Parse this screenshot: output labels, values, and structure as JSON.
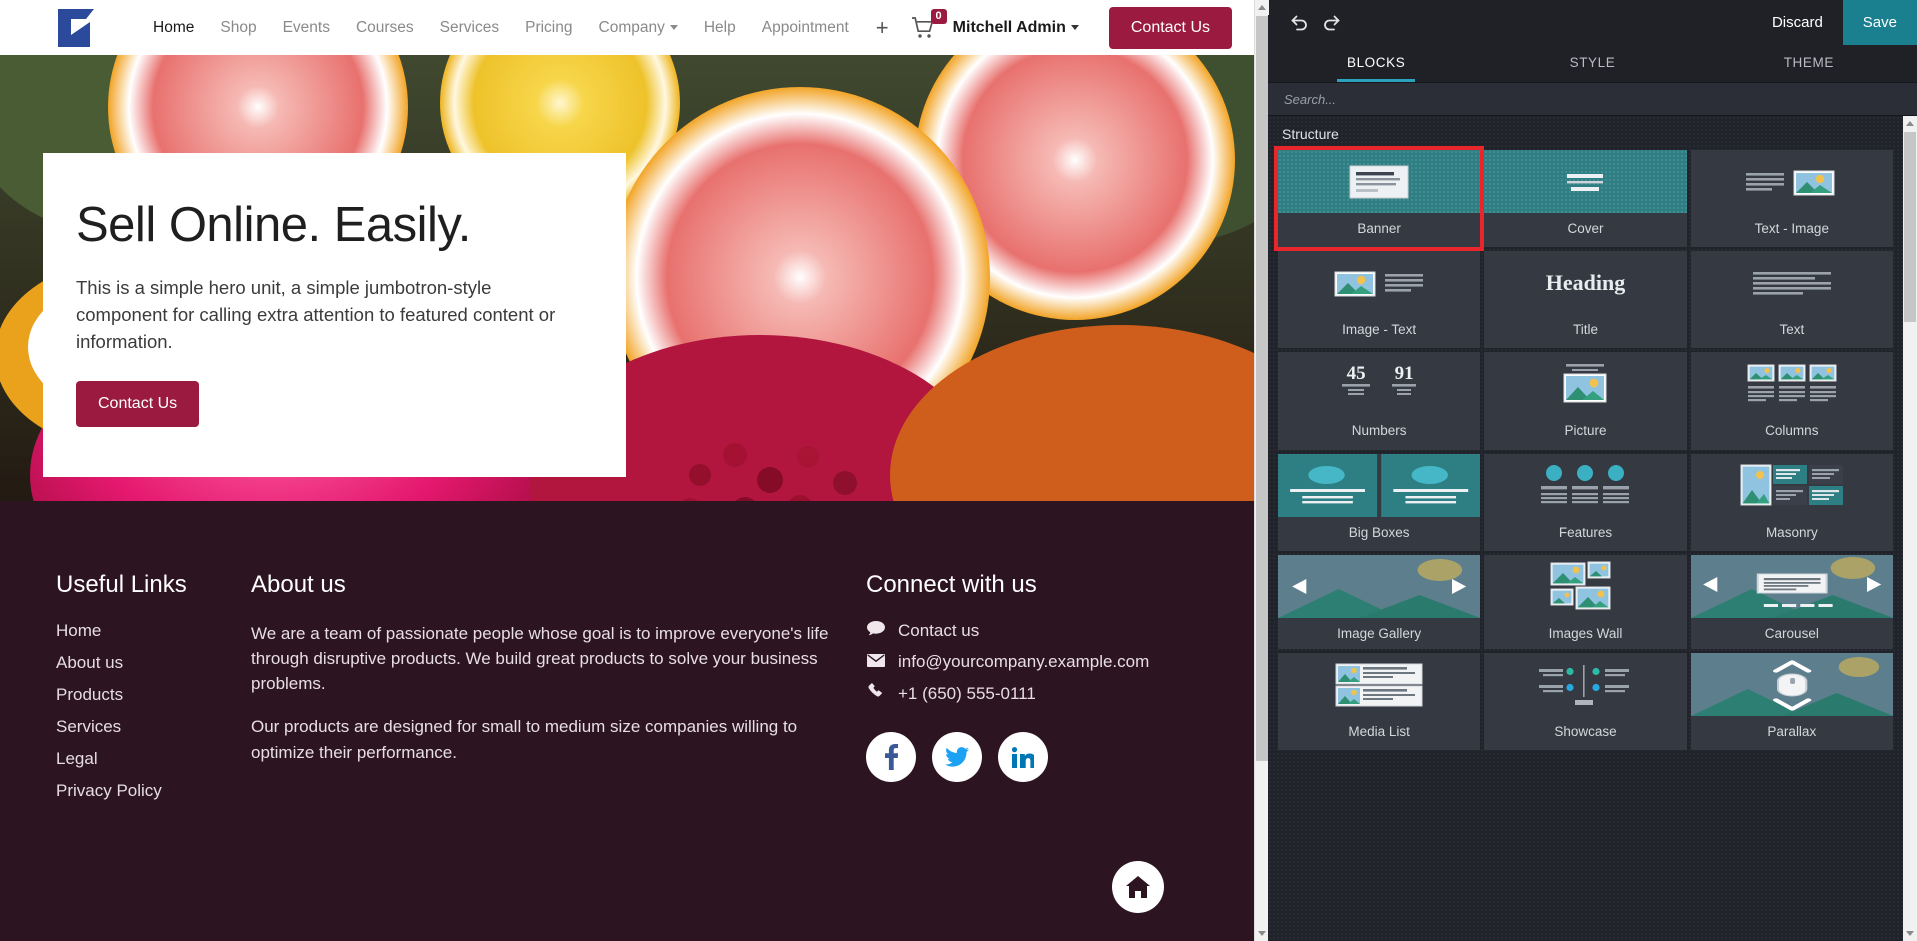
{
  "site": {
    "brand": "company-logo",
    "nav": [
      {
        "label": "Home",
        "active": true,
        "caret": false
      },
      {
        "label": "Shop",
        "active": false,
        "caret": false
      },
      {
        "label": "Events",
        "active": false,
        "caret": false
      },
      {
        "label": "Courses",
        "active": false,
        "caret": false
      },
      {
        "label": "Services",
        "active": false,
        "caret": false
      },
      {
        "label": "Pricing",
        "active": false,
        "caret": false
      },
      {
        "label": "Company",
        "active": false,
        "caret": true
      },
      {
        "label": "Help",
        "active": false,
        "caret": false
      },
      {
        "label": "Appointment",
        "active": false,
        "caret": false
      }
    ],
    "plus_label": "+",
    "cart_count": "0",
    "user": "Mitchell Admin",
    "header_cta": "Contact Us"
  },
  "hero": {
    "title": "Sell Online. Easily.",
    "subtitle": "This is a simple hero unit, a simple jumbotron-style component for calling extra attention to featured content or information.",
    "button": "Contact Us"
  },
  "footer": {
    "links_head": "Useful Links",
    "links": [
      "Home",
      "About us",
      "Products",
      "Services",
      "Legal",
      "Privacy Policy"
    ],
    "about_head": "About us",
    "about_p1": "We are a team of passionate people whose goal is to improve everyone's life through disruptive products. We build great products to solve your business problems.",
    "about_p2": "Our products are designed for small to medium size companies willing to optimize their performance.",
    "connect_head": "Connect with us",
    "contact_us": "Contact us",
    "email": "info@yourcompany.example.com",
    "phone": "+1 (650) 555-0111",
    "socials": [
      "facebook-icon",
      "twitter-icon",
      "linkedin-icon"
    ],
    "home_button": "home-icon"
  },
  "editor": {
    "undo": "undo-icon",
    "redo": "redo-icon",
    "discard": "Discard",
    "save": "Save",
    "tabs": [
      {
        "label": "BLOCKS",
        "active": true
      },
      {
        "label": "STYLE",
        "active": false
      },
      {
        "label": "THEME",
        "active": false
      }
    ],
    "search_placeholder": "Search...",
    "search_value": "",
    "section": "Structure",
    "accent": "#2ba3bd",
    "save_bg": "#1a7f8e",
    "selected_outline": "#e8262b",
    "blocks": [
      {
        "label": "Banner",
        "thumb": "banner-thumb",
        "style": "teal",
        "selected": true
      },
      {
        "label": "Cover",
        "thumb": "cover-thumb",
        "style": "teal",
        "selected": false
      },
      {
        "label": "Text - Image",
        "thumb": "text-image-thumb",
        "style": "dark",
        "selected": false
      },
      {
        "label": "Image - Text",
        "thumb": "image-text-thumb",
        "style": "dark",
        "selected": false
      },
      {
        "label": "Title",
        "thumb": "heading-thumb",
        "style": "dark",
        "selected": false,
        "thumb_text": "Heading"
      },
      {
        "label": "Text",
        "thumb": "text-thumb",
        "style": "dark",
        "selected": false
      },
      {
        "label": "Numbers",
        "thumb": "numbers-thumb",
        "style": "dark",
        "selected": false,
        "num1": "45",
        "num2": "91"
      },
      {
        "label": "Picture",
        "thumb": "picture-thumb",
        "style": "dark",
        "selected": false
      },
      {
        "label": "Columns",
        "thumb": "columns-thumb",
        "style": "dark",
        "selected": false
      },
      {
        "label": "Big Boxes",
        "thumb": "big-boxes-thumb",
        "style": "dark",
        "selected": false
      },
      {
        "label": "Features",
        "thumb": "features-thumb",
        "style": "dark",
        "selected": false
      },
      {
        "label": "Masonry",
        "thumb": "masonry-thumb",
        "style": "dark",
        "selected": false
      },
      {
        "label": "Image Gallery",
        "thumb": "image-gallery-thumb",
        "style": "sky",
        "selected": false
      },
      {
        "label": "Images Wall",
        "thumb": "images-wall-thumb",
        "style": "dark",
        "selected": false
      },
      {
        "label": "Carousel",
        "thumb": "carousel-thumb",
        "style": "sky",
        "selected": false
      },
      {
        "label": "Media List",
        "thumb": "media-list-thumb",
        "style": "dark",
        "selected": false
      },
      {
        "label": "Showcase",
        "thumb": "showcase-thumb",
        "style": "dark",
        "selected": false
      },
      {
        "label": "Parallax",
        "thumb": "parallax-thumb",
        "style": "sky",
        "selected": false
      }
    ]
  }
}
